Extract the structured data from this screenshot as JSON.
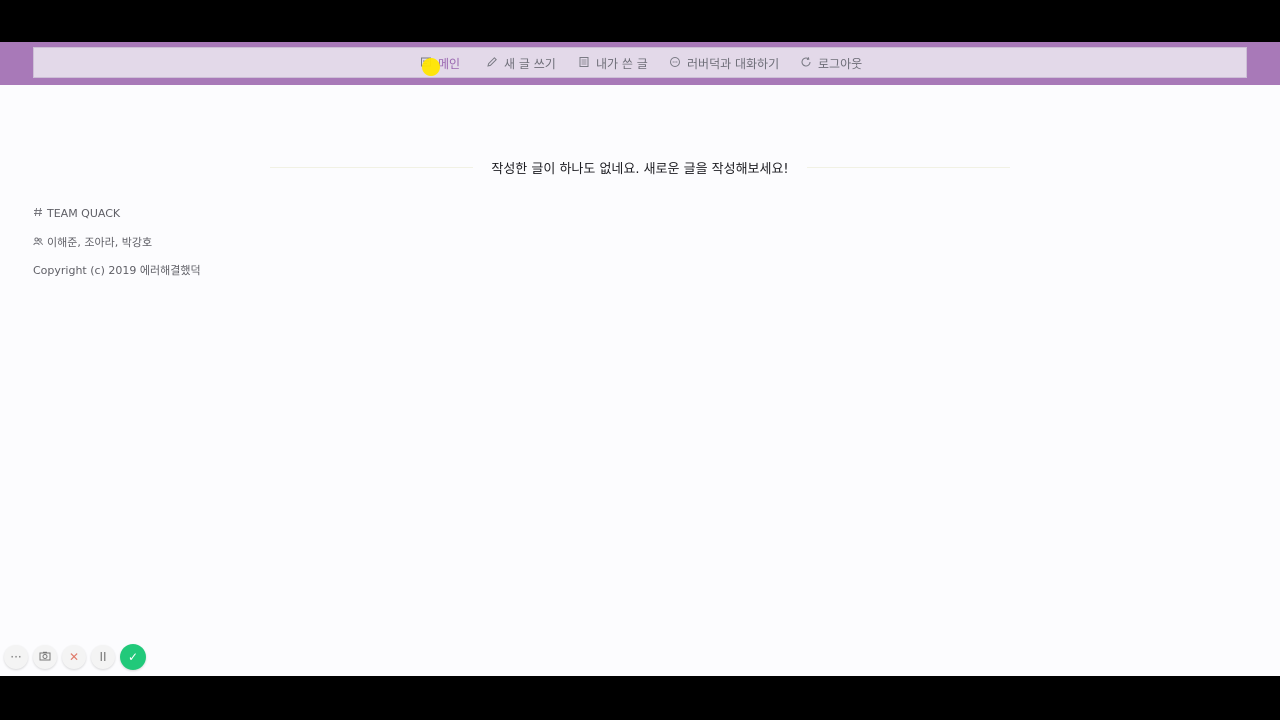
{
  "nav": {
    "items": [
      {
        "label": "메인",
        "icon": "home-icon",
        "active": true
      },
      {
        "label": "새 글 쓰기",
        "icon": "pencil-icon",
        "active": false
      },
      {
        "label": "내가 쓴 글",
        "icon": "document-icon",
        "active": false
      },
      {
        "label": "러버덕과 대화하기",
        "icon": "chat-icon",
        "active": false
      },
      {
        "label": "로그아웃",
        "icon": "refresh-icon",
        "active": false
      }
    ]
  },
  "main": {
    "empty_message": "작성한 글이 하나도 없네요. 새로운 글을 작성해보세요!"
  },
  "footer": {
    "team": "TEAM QUACK",
    "members": "이해준, 조아라, 박강호",
    "copyright": "Copyright (c) 2019 에러해결했덕"
  },
  "recorder": {
    "more_label": "···",
    "cancel_label": "✕",
    "pause_label": "II",
    "done_label": "✓"
  },
  "colors": {
    "navbar": "#a879b8",
    "nav_inner": "#e3d9e9",
    "active": "#9966b0",
    "done": "#21c97a"
  }
}
